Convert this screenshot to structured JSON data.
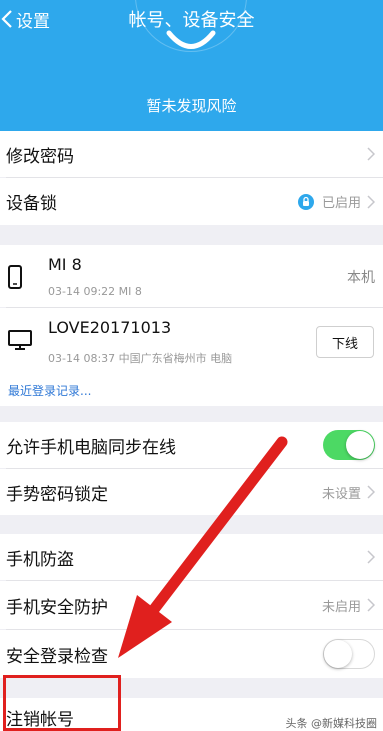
{
  "header": {
    "back_label": "设置",
    "title": "帐号、设备安全",
    "risk_status": "暂未发现风险"
  },
  "security_rows": [
    {
      "label": "修改密码"
    },
    {
      "label": "设备锁",
      "status": "已启用"
    }
  ],
  "devices": [
    {
      "name": "MI 8",
      "meta": "03-14 09:22 MI 8",
      "tag": "本机",
      "icon": "phone-icon"
    },
    {
      "name": "LOVE20171013",
      "meta": "03-14 08:37 中国广东省梅州市 电脑",
      "action": "下线",
      "icon": "desktop-icon"
    }
  ],
  "recent_login_link": "最近登录记录...",
  "sync_rows": [
    {
      "label": "允许手机电脑同步在线",
      "toggle": "on"
    },
    {
      "label": "手势密码锁定",
      "status": "未设置"
    }
  ],
  "protection_rows": [
    {
      "label": "手机防盗"
    },
    {
      "label": "手机安全防护",
      "status": "未启用"
    },
    {
      "label": "安全登录检查",
      "toggle": "off"
    }
  ],
  "cancel_account": {
    "label": "注销帐号"
  },
  "watermark": "头条 @新媒科技圈",
  "colors": {
    "header": "#2ea8ec",
    "toggle_on": "#4cd964",
    "arrow": "#e0201e",
    "link": "#2f78d6"
  }
}
